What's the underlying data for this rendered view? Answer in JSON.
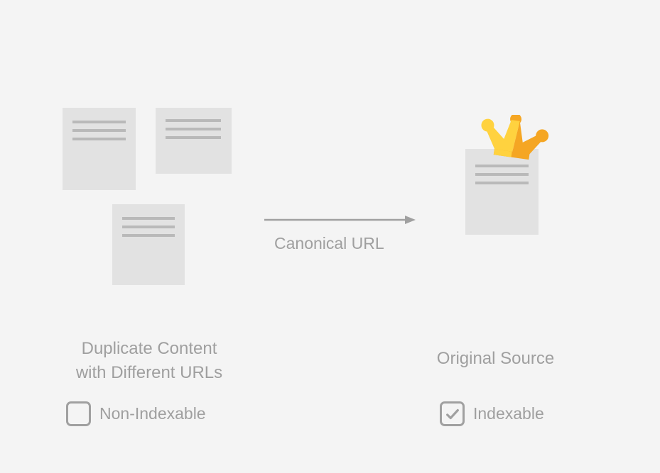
{
  "labels": {
    "canonical": "Canonical URL",
    "duplicate_line1": "Duplicate Content",
    "duplicate_line2": "with Different URLs",
    "original": "Original Source",
    "non_indexable": "Non-Indexable",
    "indexable": "Indexable"
  }
}
